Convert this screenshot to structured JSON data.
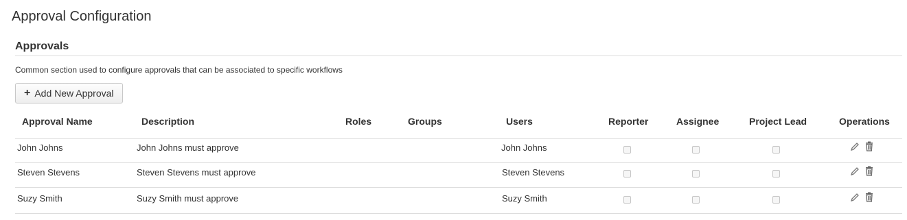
{
  "page": {
    "title": "Approval Configuration"
  },
  "approvals": {
    "title": "Approvals",
    "description": "Common section used to configure approvals that can be associated to specific workflows",
    "add_button_label": "Add New Approval"
  },
  "table": {
    "headers": {
      "approval_name": "Approval Name",
      "description": "Description",
      "roles": "Roles",
      "groups": "Groups",
      "users": "Users",
      "reporter": "Reporter",
      "assignee": "Assignee",
      "project_lead": "Project Lead",
      "operations": "Operations"
    },
    "rows": [
      {
        "name": "John Johns",
        "description": "John Johns must approve",
        "roles": "",
        "groups": "",
        "users": "John Johns",
        "reporter": false,
        "assignee": false,
        "project_lead": false
      },
      {
        "name": "Steven Stevens",
        "description": "Steven Stevens must approve",
        "roles": "",
        "groups": "",
        "users": "Steven Stevens",
        "reporter": false,
        "assignee": false,
        "project_lead": false
      },
      {
        "name": "Suzy Smith",
        "description": "Suzy Smith must approve",
        "roles": "",
        "groups": "",
        "users": "Suzy Smith",
        "reporter": false,
        "assignee": false,
        "project_lead": false
      }
    ],
    "operation_icons": [
      "pencil-icon",
      "trash-icon"
    ]
  },
  "colors": {
    "text": "#333333",
    "rule": "#dddddd",
    "checkbox_border": "#c6c6c6",
    "icon": "#777777"
  }
}
